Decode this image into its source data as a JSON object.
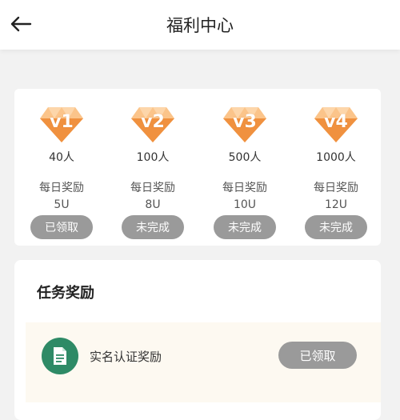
{
  "header": {
    "title": "福利中心",
    "back_icon": "arrow-left-icon"
  },
  "levels": [
    {
      "badge": "v1",
      "count": "40人",
      "daily_label": "每日奖励",
      "amount": "5U",
      "button": "已领取"
    },
    {
      "badge": "v2",
      "count": "100人",
      "daily_label": "每日奖励",
      "amount": "8U",
      "button": "未完成"
    },
    {
      "badge": "v3",
      "count": "500人",
      "daily_label": "每日奖励",
      "amount": "10U",
      "button": "未完成"
    },
    {
      "badge": "v4",
      "count": "1000人",
      "daily_label": "每日奖励",
      "amount": "12U",
      "button": "未完成"
    }
  ],
  "tasks": {
    "heading": "任务奖励",
    "items": [
      {
        "name": "实名认证奖励",
        "button": "已领取",
        "icon": "document-icon"
      }
    ]
  },
  "colors": {
    "gem_light": "#fbc48a",
    "gem_dark": "#f0913f",
    "button_gray": "#9a9a9a",
    "task_icon_bg": "#2e8a66",
    "task_row_bg": "#fdf9f1"
  }
}
